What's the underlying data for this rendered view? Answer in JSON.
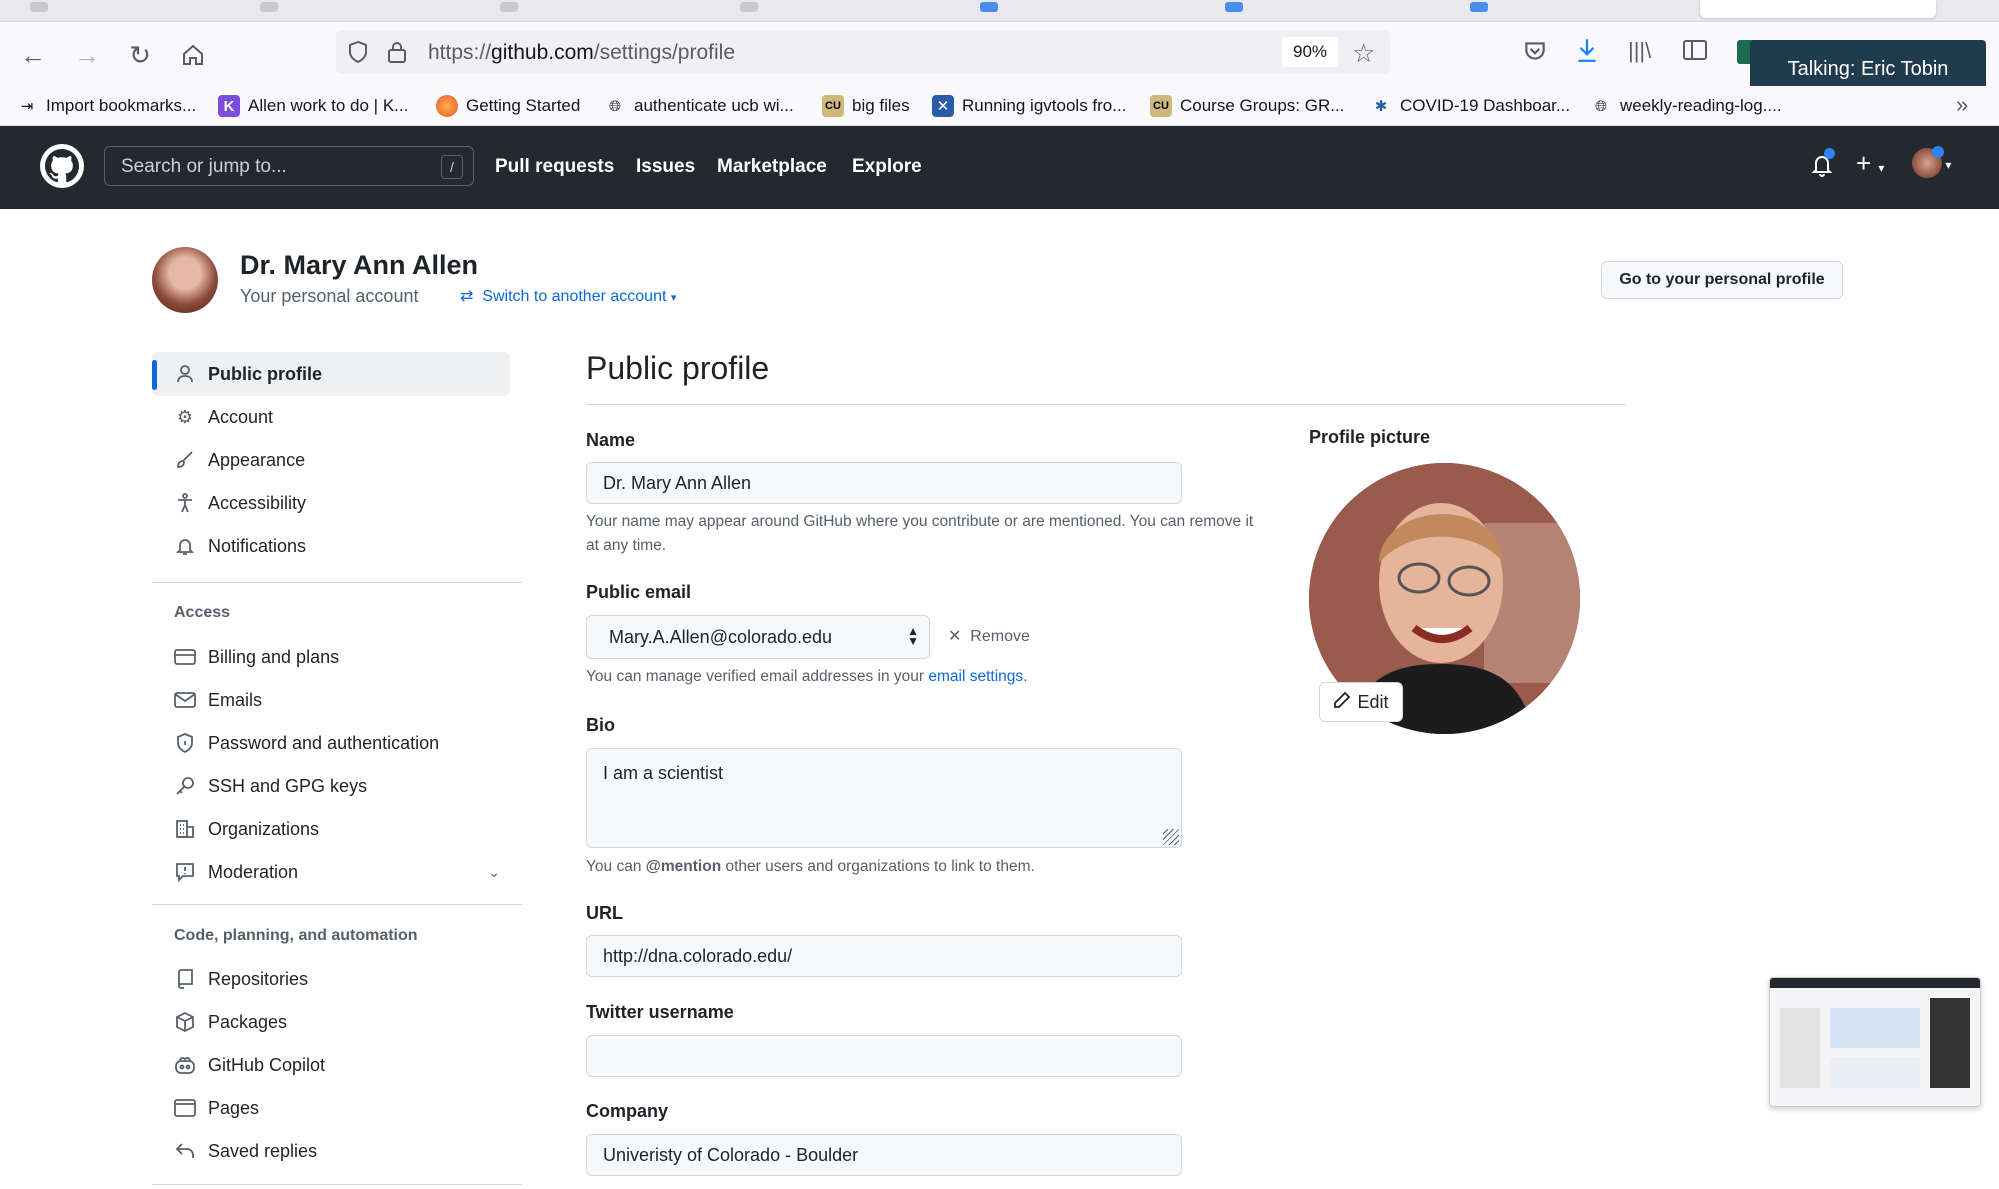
{
  "browser": {
    "url_prefix": "https://",
    "url_host": "github.com",
    "url_path": "/settings/profile",
    "zoom": "90%",
    "tooltip": "Talking: Eric Tobin",
    "bookmarks": [
      {
        "label": "Import bookmarks...",
        "icon": "import-icon"
      },
      {
        "label": "Allen work to do | K...",
        "icon": "k-icon"
      },
      {
        "label": "Getting Started",
        "icon": "firefox-icon"
      },
      {
        "label": "authenticate ucb wi...",
        "icon": "globe-icon"
      },
      {
        "label": "big files",
        "icon": "cu-icon"
      },
      {
        "label": "Running igvtools fro...",
        "icon": "igv-icon"
      },
      {
        "label": "Course Groups: GR...",
        "icon": "cu-icon"
      },
      {
        "label": "COVID-19 Dashboar...",
        "icon": "covid-icon"
      },
      {
        "label": "weekly-reading-log....",
        "icon": "globe-icon"
      }
    ]
  },
  "gh_header": {
    "search_placeholder": "Search or jump to...",
    "search_shortcut": "/",
    "nav": [
      "Pull requests",
      "Issues",
      "Marketplace",
      "Explore"
    ]
  },
  "account": {
    "name": "Dr. Mary Ann Allen",
    "subtitle": "Your personal account",
    "switch_label": "Switch to another account",
    "go_profile_label": "Go to your personal profile"
  },
  "sidebar": {
    "top_items": [
      {
        "label": "Public profile",
        "icon": "person-icon"
      },
      {
        "label": "Account",
        "icon": "gear-icon"
      },
      {
        "label": "Appearance",
        "icon": "paintbrush-icon"
      },
      {
        "label": "Accessibility",
        "icon": "accessibility-icon"
      },
      {
        "label": "Notifications",
        "icon": "bell-icon"
      }
    ],
    "access_heading": "Access",
    "access_items": [
      {
        "label": "Billing and plans",
        "icon": "credit-card-icon"
      },
      {
        "label": "Emails",
        "icon": "mail-icon"
      },
      {
        "label": "Password and authentication",
        "icon": "shield-lock-icon"
      },
      {
        "label": "SSH and GPG keys",
        "icon": "key-icon"
      },
      {
        "label": "Organizations",
        "icon": "organization-icon"
      },
      {
        "label": "Moderation",
        "icon": "report-icon"
      }
    ],
    "code_heading": "Code, planning, and automation",
    "code_items": [
      {
        "label": "Repositories",
        "icon": "repo-icon"
      },
      {
        "label": "Packages",
        "icon": "package-icon"
      },
      {
        "label": "GitHub Copilot",
        "icon": "copilot-icon"
      },
      {
        "label": "Pages",
        "icon": "browser-icon"
      },
      {
        "label": "Saved replies",
        "icon": "reply-icon"
      }
    ]
  },
  "main": {
    "title": "Public profile",
    "name_label": "Name",
    "name_value": "Dr. Mary Ann Allen",
    "name_note": "Your name may appear around GitHub where you contribute or are mentioned. You can remove it at any time.",
    "email_label": "Public email",
    "email_value": "Mary.A.Allen@colorado.edu",
    "remove_label": "Remove",
    "email_note_prefix": "You can manage verified email addresses in your",
    "email_note_link": "email settings",
    "email_note_suffix": ".",
    "bio_label": "Bio",
    "bio_value": "I am a scientist",
    "bio_note_prefix": "You can",
    "bio_note_mention": "@mention",
    "bio_note_suffix": "other users and organizations to link to them.",
    "url_label": "URL",
    "url_value": "http://dna.colorado.edu/",
    "twitter_label": "Twitter username",
    "twitter_value": "",
    "company_label": "Company",
    "company_value": "Univeristy of Colorado - Boulder",
    "picture_label": "Profile picture",
    "edit_label": "Edit"
  }
}
